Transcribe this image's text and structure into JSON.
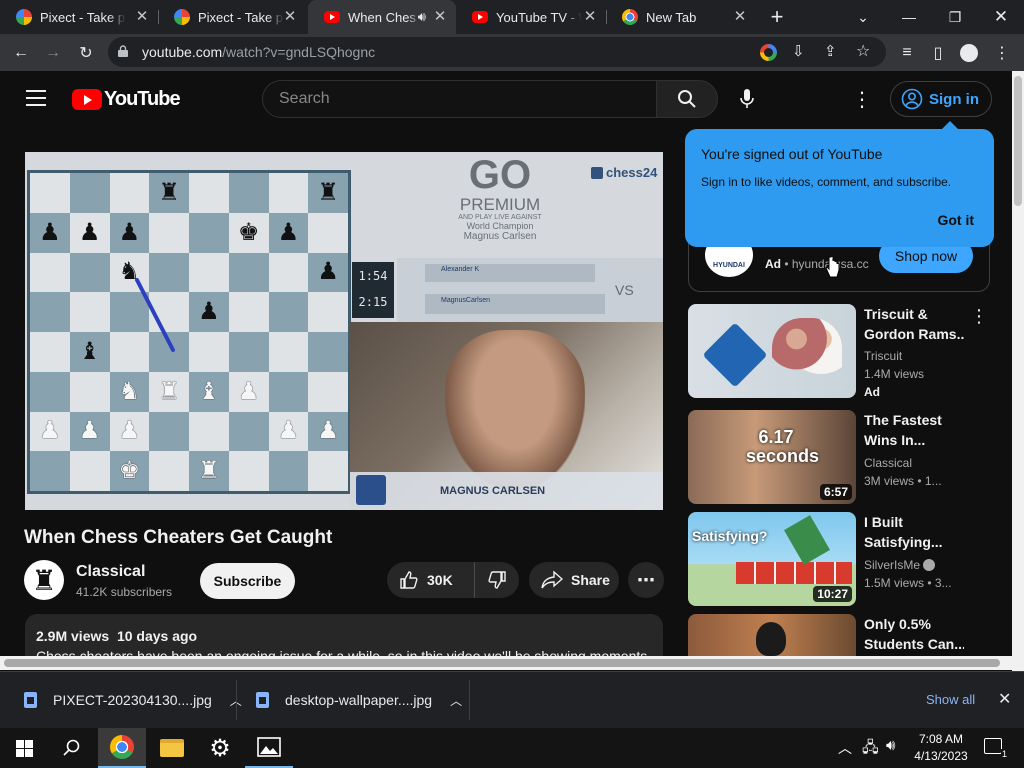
{
  "browser": {
    "tabs": [
      {
        "title": "Pixect - Take ph",
        "favicon": "pixect-icon",
        "active": false
      },
      {
        "title": "Pixect - Take ph",
        "favicon": "pixect-icon",
        "active": false
      },
      {
        "title": "When Ches",
        "favicon": "youtube-icon",
        "active": true,
        "audio": true
      },
      {
        "title": "YouTube TV - W",
        "favicon": "youtube-icon",
        "active": false
      },
      {
        "title": "New Tab",
        "favicon": "chrome-icon",
        "active": false
      }
    ],
    "new_tab": "+",
    "url_host": "youtube.com",
    "url_path": "/watch?v=gndLSQhognc"
  },
  "youtube": {
    "logo_text": "YouTube",
    "search_placeholder": "Search",
    "sign_in": "Sign in",
    "tooltip": {
      "title": "You're signed out of YouTube",
      "body": "Sign in to like videos, comment, and subscribe.",
      "button": "Got it"
    },
    "ad": {
      "brand": "HYUNDAI",
      "label": "Ad",
      "domain": "hyundaiusa.cc",
      "button": "Shop now"
    },
    "player": {
      "premium_title": "GO",
      "premium_sub": "PREMIUM",
      "premium_tag": "AND PLAY LIVE AGAINST",
      "premium_champ": "World Champion",
      "premium_name": "Magnus Carlsen",
      "brand": "chess24",
      "clock_top": "1:54",
      "clock_bottom": "2:15",
      "player_top": "Alexander K",
      "player_bottom": "MagnusCarlsen",
      "vs": "VS",
      "caption": "MAGNUS CARLSEN",
      "board": [
        [
          "",
          "",
          "",
          "bR",
          "",
          "",
          "",
          "bR"
        ],
        [
          "bP",
          "bP",
          "bP",
          "",
          "",
          "bK",
          "bP",
          ""
        ],
        [
          "",
          "",
          "bN",
          "",
          "",
          "",
          "",
          "bP"
        ],
        [
          "",
          "",
          "",
          "",
          "bP",
          "",
          "",
          ""
        ],
        [
          "",
          "bB",
          "",
          "",
          "",
          "",
          "",
          ""
        ],
        [
          "",
          "",
          "wN",
          "wR",
          "wB",
          "wP",
          "",
          ""
        ],
        [
          "wP",
          "wP",
          "wP",
          "",
          "",
          "",
          "wP",
          "wP"
        ],
        [
          "",
          "",
          "wK",
          "",
          "wR",
          "",
          "",
          ""
        ]
      ]
    },
    "video": {
      "title": "When Chess Cheaters Get Caught",
      "channel": "Classical",
      "subscribers": "41.2K subscribers",
      "subscribe": "Subscribe",
      "likes": "30K",
      "share": "Share",
      "views": "2.9M views",
      "age": "10 days ago",
      "description": "Chess cheaters have been an ongoing issue for a while, so in this video we'll be showing moments"
    },
    "recommendations": [
      {
        "title1": "Triscuit &",
        "title2": "Gordon Rams...",
        "channel": "Triscuit",
        "meta": "1.4M views",
        "extra": "Ad",
        "duration": "",
        "thumb_text": ""
      },
      {
        "title1": "The Fastest",
        "title2": "Wins In...",
        "channel": "Classical",
        "meta": "3M views  • 1...",
        "extra": "",
        "duration": "6:57",
        "thumb_text": "6.17 seconds"
      },
      {
        "title1": "I Built",
        "title2": "Satisfying...",
        "channel": "SilverIsMe",
        "meta": "1.5M views  • 3...",
        "extra": "",
        "duration": "10:27",
        "thumb_text": "Satisfying?"
      },
      {
        "title1": "Only 0.5%",
        "title2": "Students Can...",
        "channel": "",
        "meta": "",
        "extra": "",
        "duration": "",
        "thumb_text": ""
      }
    ]
  },
  "downloads": {
    "items": [
      "PIXECT-202304130....jpg",
      "desktop-wallpaper....jpg"
    ],
    "show_all": "Show all"
  },
  "taskbar": {
    "time": "7:08 AM",
    "date": "4/13/2023",
    "notifications": "1"
  },
  "colors": {
    "accent_blue": "#3ea6ff",
    "tooltip_blue": "#2f9bf0",
    "youtube_red": "#ff0000"
  }
}
